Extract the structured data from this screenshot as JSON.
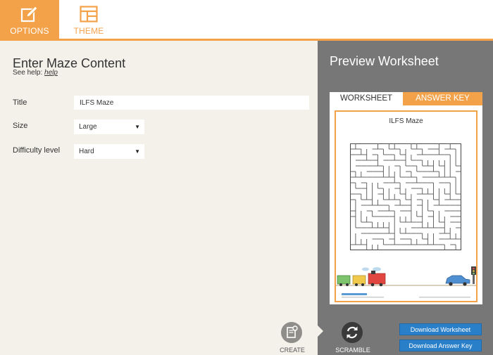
{
  "tabs": {
    "options": "OPTIONS",
    "theme": "THEME"
  },
  "form": {
    "heading": "Enter Maze Content",
    "help_prefix": "See help:",
    "help_link": "help",
    "title_label": "Title",
    "title_value": "ILFS Maze",
    "size_label": "Size",
    "size_value": "Large",
    "difficulty_label": "Difficulty level",
    "difficulty_value": "Hard"
  },
  "preview": {
    "heading": "Preview Worksheet",
    "tab_worksheet": "WORKSHEET",
    "tab_answer_key": "ANSWER KEY",
    "sheet_title": "ILFS Maze"
  },
  "actions": {
    "create": "CREATE",
    "scramble": "SCRAMBLE",
    "download_worksheet": "Download Worksheet",
    "download_answer_key": "Download Answer Key"
  },
  "icons": {
    "options": "edit-icon",
    "theme": "layout-icon",
    "create": "new-document-icon",
    "scramble": "refresh-icon"
  },
  "colors": {
    "accent": "#f3a24a",
    "button_blue": "#2a7fc9",
    "panel_gray": "#777777",
    "panel_beige": "#f3f1ea"
  }
}
